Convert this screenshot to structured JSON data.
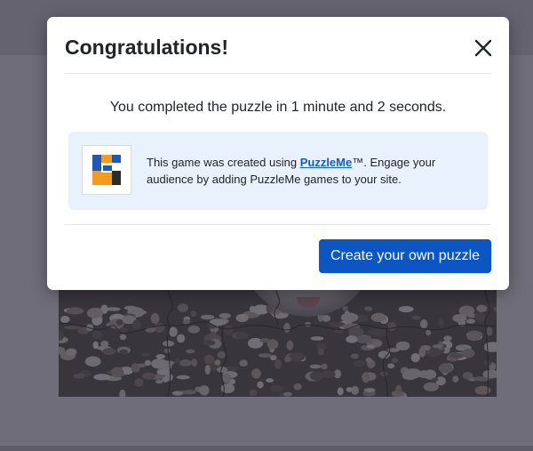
{
  "modal": {
    "title": "Congratulations!",
    "close_icon": "close-icon",
    "message": "You completed the puzzle in 1 minute and 2 seconds.",
    "promo": {
      "logo_icon": "puzzleme-logo",
      "text_before": "This game was created using ",
      "link_text": "PuzzleMe",
      "text_after": "™. Engage your audience by adding PuzzleMe games to your site."
    },
    "create_button_label": "Create your own puzzle"
  },
  "colors": {
    "accent": "#0b56c2",
    "link": "#0b5ed7",
    "promo_bg": "#e8f1fc",
    "overlay": "#232134",
    "logo_blue": "#1b58b8",
    "logo_orange": "#f29b1d",
    "logo_dark": "#2b2b2b"
  }
}
